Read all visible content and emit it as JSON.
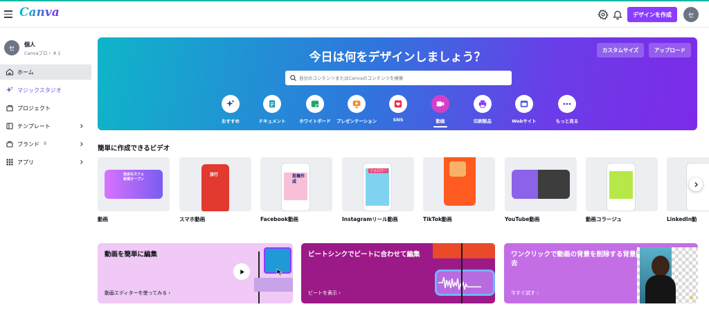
{
  "app": {
    "logo_text": "Canva",
    "create_button": "デザインを作成",
    "avatar_initial": "セ",
    "icons": [
      "menu-icon",
      "gear-icon",
      "bell-icon"
    ]
  },
  "sidebar": {
    "account_initial": "セ",
    "account_name": "個人",
    "account_plan": "Canvaプロ・ 8 1",
    "items": [
      {
        "label": "ホーム",
        "icon": "home-icon",
        "active": true
      },
      {
        "label": "マジックスタジオ",
        "icon": "sparkle-icon"
      },
      {
        "label": "プロジェクト",
        "icon": "folder-icon"
      },
      {
        "label": "テンプレート",
        "icon": "template-icon",
        "chevron": true
      },
      {
        "label": "ブランド",
        "icon": "brand-icon",
        "chevron": true
      },
      {
        "label": "アプリ",
        "icon": "apps-grid-icon",
        "chevron": true
      }
    ]
  },
  "hero": {
    "title": "今日は何をデザインしましょう？",
    "custom_size_button": "カスタムサイズ",
    "upload_button": "アップロード",
    "search_placeholder": "自分のコンテンツまたはCanvaのコンテンツを検索",
    "categories": [
      {
        "label": "おすすめ",
        "icon": "sparkle-icon",
        "color": "#2f3e9e"
      },
      {
        "label": "ドキュメント",
        "icon": "document-icon",
        "color": "#13a3b5"
      },
      {
        "label": "ホワイトボード",
        "icon": "whiteboard-icon",
        "color": "#1ea672"
      },
      {
        "label": "プレゼンテーション",
        "icon": "presentation-icon",
        "color": "#f08a1c"
      },
      {
        "label": "SNS",
        "icon": "heart-icon",
        "color": "#f0314f"
      },
      {
        "label": "動画",
        "icon": "video-icon",
        "color": "#ffffff",
        "active": true
      },
      {
        "label": "印刷製品",
        "icon": "printer-icon",
        "color": "#8b3dff"
      },
      {
        "label": "Webサイト",
        "icon": "website-icon",
        "color": "#4a57d6"
      },
      {
        "label": "もっと見る",
        "icon": "more-icon",
        "color": "#6a3de8"
      }
    ]
  },
  "video_section": {
    "title": "簡単に作成できるビデオ",
    "cards": [
      {
        "label": "動画",
        "thumb_text": "自由なカフェ新規オープン"
      },
      {
        "label": "スマホ動画",
        "thumb_text": "旅行"
      },
      {
        "label": "Facebook動画",
        "thumb_text": "投稿作成"
      },
      {
        "label": "Instagramリール動画",
        "thumb_text": "フォロワー"
      },
      {
        "label": "TikTok動画",
        "thumb_text": ""
      },
      {
        "label": "YouTube動画",
        "thumb_text": ""
      },
      {
        "label": "動画コラージュ",
        "thumb_text": ""
      },
      {
        "label": "LinkedIn動",
        "thumb_text": ""
      }
    ]
  },
  "promos": [
    {
      "title": "動画を簡単に編集",
      "link": "動画エディターを使ってみる ›"
    },
    {
      "title": "ビートシンクでビートに合わせて編集",
      "link": "ビートを表示 ›"
    },
    {
      "title": "ワンクリックで動画の背景を削除する背景除去",
      "link": "今すぐ試す ›"
    }
  ]
}
